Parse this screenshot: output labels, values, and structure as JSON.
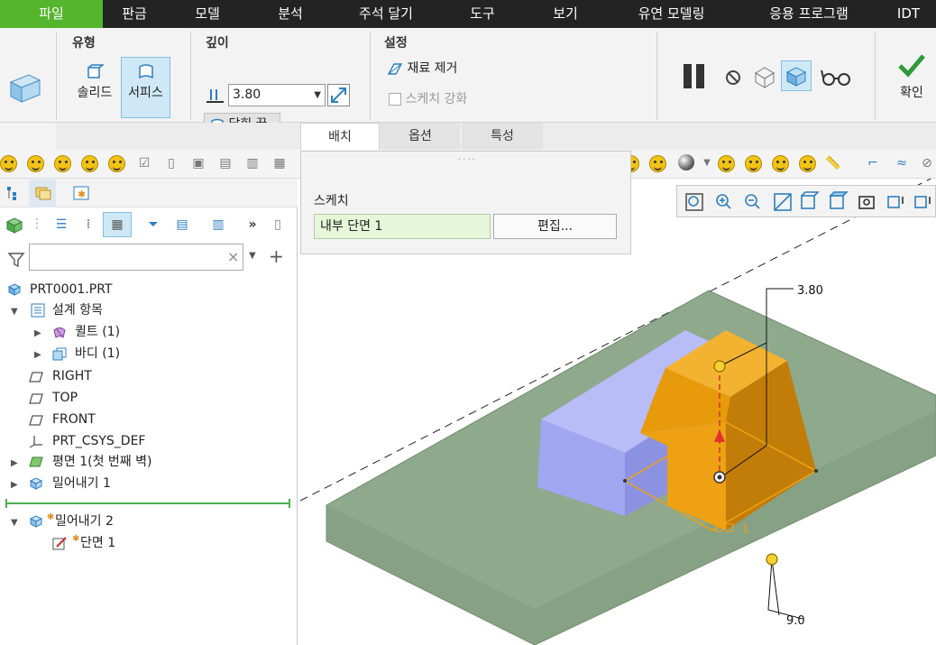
{
  "menu": [
    "파일",
    "판금",
    "모델",
    "분석",
    "주석 달기",
    "도구",
    "보기",
    "유연 모델링",
    "응용 프로그램",
    "IDT"
  ],
  "type_group": {
    "title": "유형",
    "solid": "솔리드",
    "surface": "서피스"
  },
  "depth_group": {
    "title": "깊이",
    "value": "3.80",
    "capped": "닫힌 끝"
  },
  "settings_group": {
    "title": "설정",
    "remove_material": "재료 제거",
    "thicken_sketch": "스케치 강화"
  },
  "confirm": "확인",
  "ribbon_tabs": [
    "배치",
    "옵션",
    "특성"
  ],
  "placement_panel": {
    "label": "스케치",
    "sketch_name": "내부 단면 1",
    "edit_button": "편집..."
  },
  "tree": {
    "root": "PRT0001.PRT",
    "items": [
      "설계 항목",
      "퀼트 (1)",
      "바디 (1)",
      "RIGHT",
      "TOP",
      "FRONT",
      "PRT_CSYS_DEF",
      "평면 1(첫 번째 벽)",
      "밀어내기 1",
      "밀어내기 2",
      "단면 1"
    ]
  },
  "viewport": {
    "dim_depth": "3.80",
    "dim_angle": "9.0",
    "section_label": "1"
  },
  "colors": {
    "accent_green": "#55b52d",
    "solid_orange": "#f0a20e",
    "plane_green": "#8fa98d",
    "body_blue": "#a0a6f0"
  }
}
